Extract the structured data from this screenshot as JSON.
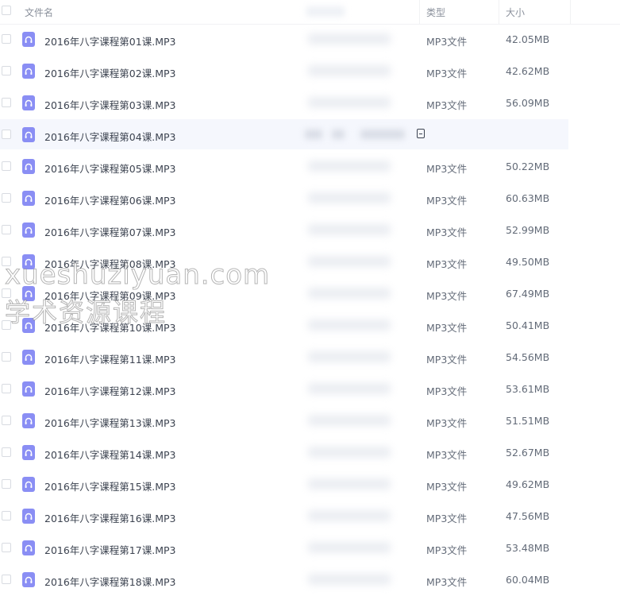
{
  "header": {
    "name_label": "文件名",
    "type_label": "类型",
    "size_label": "大小"
  },
  "rows": [
    {
      "name": "2016年八字课程第01课.MP3",
      "type": "MP3文件",
      "size": "42.05MB"
    },
    {
      "name": "2016年八字课程第02课.MP3",
      "type": "MP3文件",
      "size": "42.62MB"
    },
    {
      "name": "2016年八字课程第03课.MP3",
      "type": "MP3文件",
      "size": "56.09MB"
    },
    {
      "name": "2016年八字课程第04课.MP3",
      "type": "",
      "size": ""
    },
    {
      "name": "2016年八字课程第05课.MP3",
      "type": "MP3文件",
      "size": "50.22MB"
    },
    {
      "name": "2016年八字课程第06课.MP3",
      "type": "MP3文件",
      "size": "60.63MB"
    },
    {
      "name": "2016年八字课程第07课.MP3",
      "type": "MP3文件",
      "size": "52.99MB"
    },
    {
      "name": "2016年八字课程第08课.MP3",
      "type": "MP3文件",
      "size": "49.50MB"
    },
    {
      "name": "2016年八字课程第09课.MP3",
      "type": "MP3文件",
      "size": "67.49MB"
    },
    {
      "name": "2016年八字课程第10课.MP3",
      "type": "MP3文件",
      "size": "50.41MB"
    },
    {
      "name": "2016年八字课程第11课.MP3",
      "type": "MP3文件",
      "size": "54.56MB"
    },
    {
      "name": "2016年八字课程第12课.MP3",
      "type": "MP3文件",
      "size": "53.61MB"
    },
    {
      "name": "2016年八字课程第13课.MP3",
      "type": "MP3文件",
      "size": "51.51MB"
    },
    {
      "name": "2016年八字课程第14课.MP3",
      "type": "MP3文件",
      "size": "52.67MB"
    },
    {
      "name": "2016年八字课程第15课.MP3",
      "type": "MP3文件",
      "size": "49.62MB"
    },
    {
      "name": "2016年八字课程第16课.MP3",
      "type": "MP3文件",
      "size": "47.56MB"
    },
    {
      "name": "2016年八字课程第17课.MP3",
      "type": "MP3文件",
      "size": "53.48MB"
    },
    {
      "name": "2016年八字课程第18课.MP3",
      "type": "MP3文件",
      "size": "60.04MB"
    }
  ],
  "hover_row_index": 3,
  "icons": {
    "file": "audio-file-icon",
    "hover_action": "document-icon"
  },
  "colors": {
    "icon_bg": "#8a8ef4",
    "hover_bg": "#f5f7fd"
  },
  "watermark": {
    "line1": "xueshuziyuan.com",
    "line2": "学术资源课程"
  }
}
